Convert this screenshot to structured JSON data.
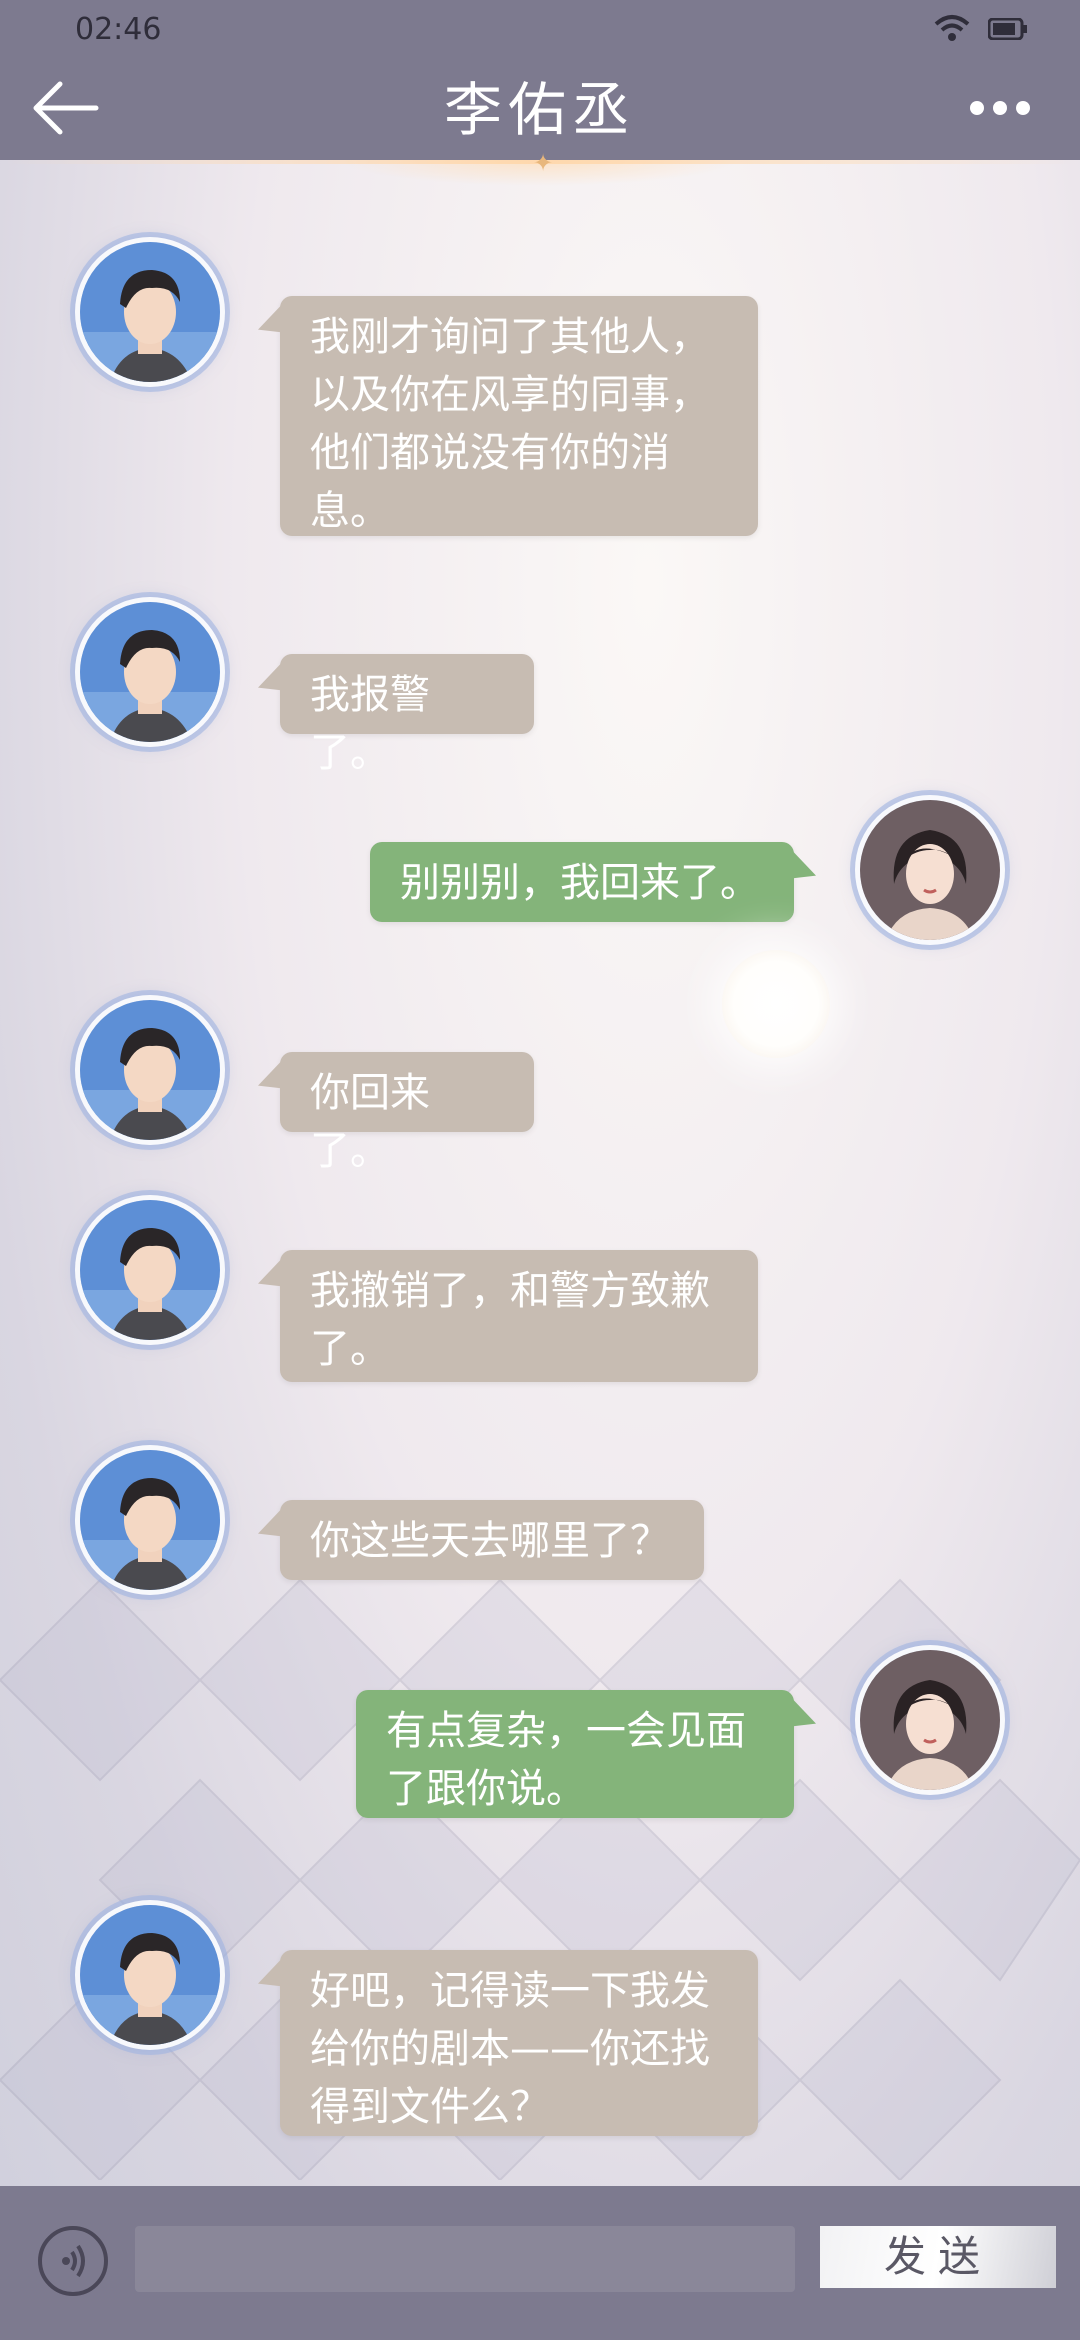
{
  "status_bar": {
    "time": "02:46"
  },
  "header": {
    "title": "李佑丞"
  },
  "messages": [
    {
      "side": "in",
      "text": "我刚才询问了其他人，以及你在风享的同事，他们都说没有你的消息。"
    },
    {
      "side": "in",
      "text": "我报警了。"
    },
    {
      "side": "out",
      "text": "别别别，我回来了。"
    },
    {
      "side": "in",
      "text": "你回来了。"
    },
    {
      "side": "in",
      "text": "我撤销了，和警方致歉了。"
    },
    {
      "side": "in",
      "text": "你这些天去哪里了？"
    },
    {
      "side": "out",
      "text": "有点复杂，一会见面了跟你说。"
    },
    {
      "side": "in",
      "text": "好吧，记得读一下我发给你的剧本——你还找得到文件么？"
    }
  ],
  "input_bar": {
    "send_label": "发送"
  },
  "colors": {
    "incoming_bubble": "#c7bcb2",
    "outgoing_bubble": "#84b47a",
    "header": "#7d7a8f"
  },
  "icons": [
    "back-arrow-icon",
    "more-dots-icon",
    "wifi-icon",
    "battery-icon",
    "voice-icon"
  ]
}
